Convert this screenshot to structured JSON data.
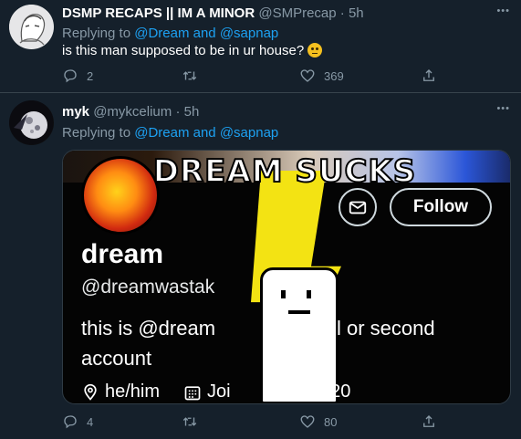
{
  "tweets": [
    {
      "name": "DSMP RECAPS || IM A MINOR",
      "handle": "@SMPrecap",
      "dot": "·",
      "time": "5h",
      "replying_prefix": "Replying to",
      "replying_to_1": "@Dream",
      "replying_and": "and",
      "replying_to_2": "@sapnap",
      "text": "is this man supposed to be in ur house?",
      "emoji": "face-with-raised-eyebrow",
      "reply_count": "2",
      "retweet_count": "",
      "like_count": "369"
    },
    {
      "name": "myk",
      "handle": "@mykcelium",
      "dot": "·",
      "time": "5h",
      "replying_prefix": "Replying to",
      "replying_to_1": "@Dream",
      "replying_and": "and",
      "replying_to_2": "@sapnap",
      "reply_count": "4",
      "retweet_count": "",
      "like_count": "80",
      "media": {
        "headline": "DREAM SUCKS",
        "follow_label": "Follow",
        "profile_name": "dream",
        "profile_handle": "@dreamwastak",
        "bio_line1_a": "this is @dream",
        "bio_line1_b": "l or second",
        "bio_line2": "account",
        "pronouns": "he/him",
        "joined": "Joi",
        "joined_year": "020"
      }
    }
  ],
  "more_label": "•••",
  "colors": {
    "background": "#15202b",
    "link": "#1da1f2",
    "muted": "#8899a6",
    "divider": "#38444d"
  }
}
